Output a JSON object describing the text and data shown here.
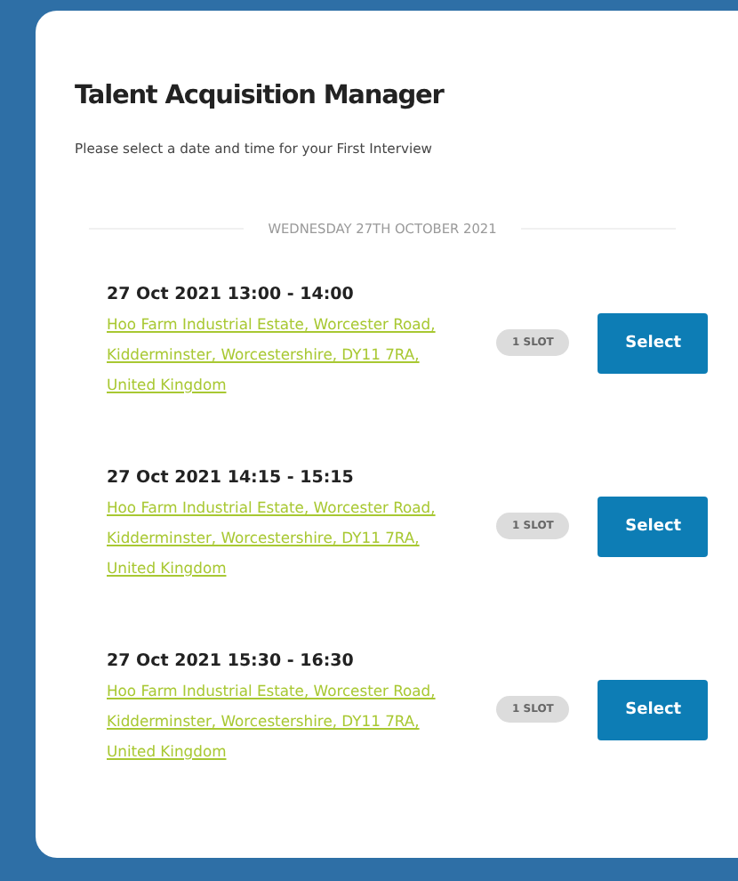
{
  "title": "Talent Acquisition Manager",
  "subtitle": "Please select a date and time for your First Interview",
  "date_header": "WEDNESDAY 27TH OCTOBER 2021",
  "slots": [
    {
      "time": "27 Oct 2021 13:00 - 14:00",
      "address": "Hoo Farm Industrial Estate, Worcester Road, Kidderminster, Worcestershire, DY11 7RA, United Kingdom",
      "badge": "1 SLOT",
      "button": "Select"
    },
    {
      "time": "27 Oct 2021 14:15 - 15:15",
      "address": "Hoo Farm Industrial Estate, Worcester Road, Kidderminster, Worcestershire, DY11 7RA, United Kingdom",
      "badge": "1 SLOT",
      "button": "Select"
    },
    {
      "time": "27 Oct 2021 15:30 - 16:30",
      "address": "Hoo Farm Industrial Estate, Worcester Road, Kidderminster, Worcestershire, DY11 7RA, United Kingdom",
      "badge": "1 SLOT",
      "button": "Select"
    }
  ]
}
